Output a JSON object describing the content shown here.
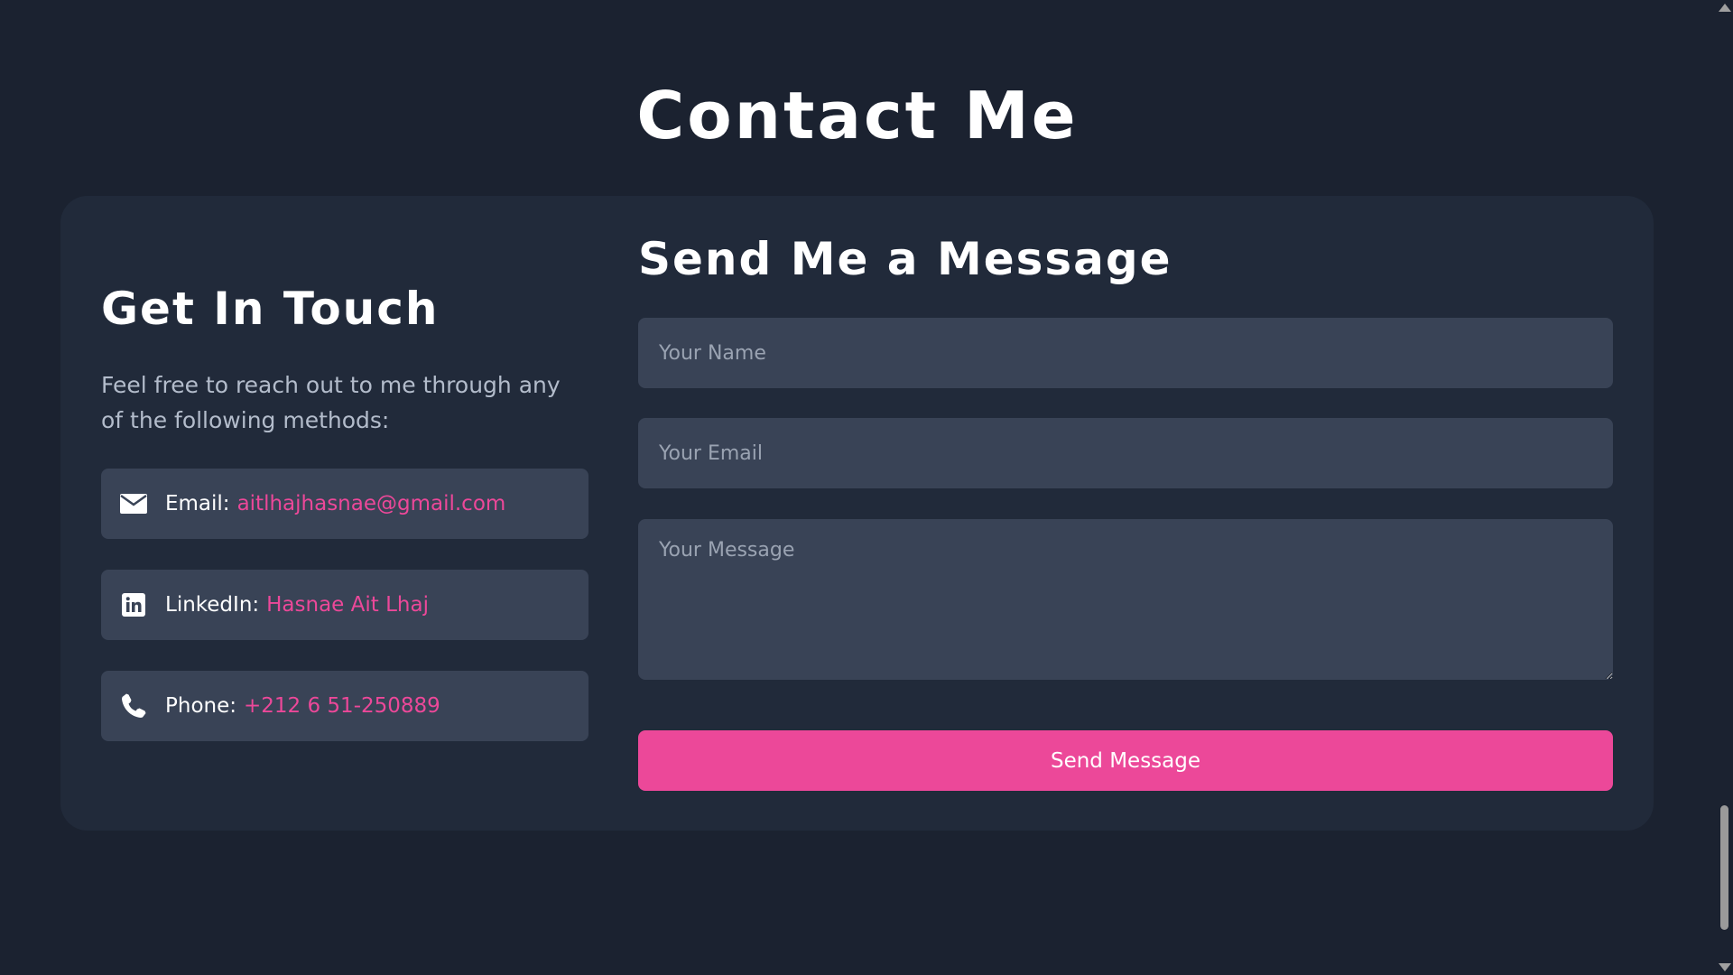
{
  "page": {
    "title": "Contact Me"
  },
  "contact_info": {
    "heading": "Get In Touch",
    "description": "Feel free to reach out to me through any of the following methods:",
    "items": [
      {
        "icon": "envelope-icon",
        "label": "Email:",
        "value": "aitlhajhasnae@gmail.com"
      },
      {
        "icon": "linkedin-icon",
        "label": "LinkedIn:",
        "value": "Hasnae Ait Lhaj"
      },
      {
        "icon": "phone-icon",
        "label": "Phone:",
        "value": "+212 6 51-250889"
      }
    ]
  },
  "form": {
    "heading": "Send Me a Message",
    "name_placeholder": "Your Name",
    "email_placeholder": "Your Email",
    "message_placeholder": "Your Message",
    "submit_label": "Send Message"
  },
  "colors": {
    "background": "#1b2230",
    "card": "#212a3a",
    "field": "#394356",
    "accent": "#ec4899"
  }
}
